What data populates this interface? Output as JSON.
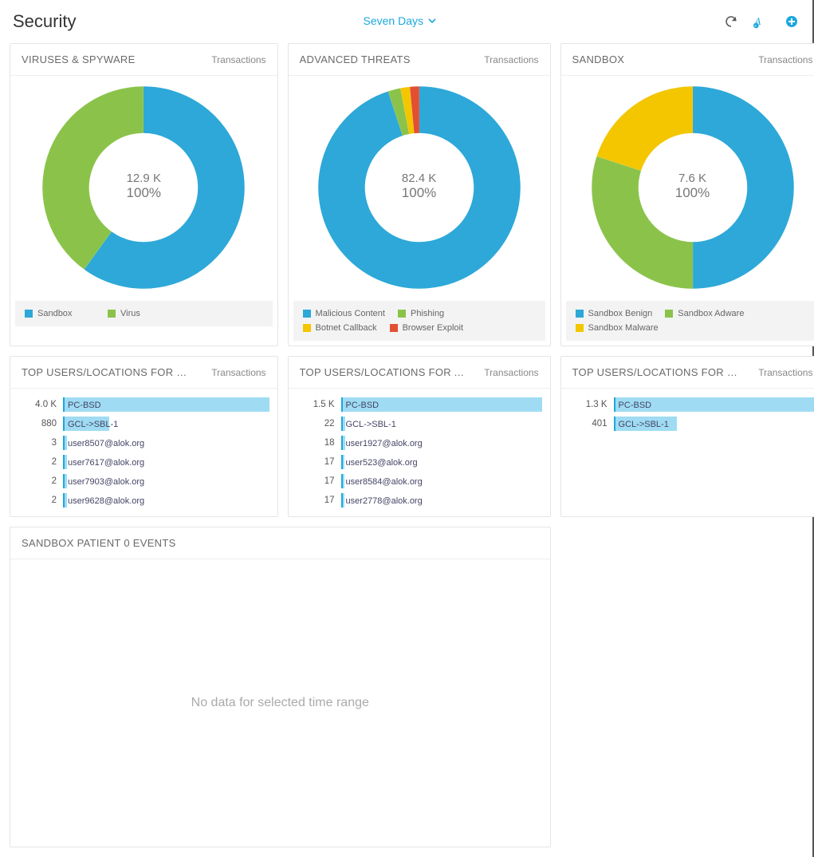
{
  "header": {
    "title": "Security",
    "timerange_label": "Seven Days"
  },
  "transactions_label": "Transactions",
  "chart_data": [
    {
      "id": "viruses",
      "type": "pie",
      "title": "VIRUSES & SPYWARE",
      "center_value": "12.9 K",
      "center_pct": "100%",
      "series": [
        {
          "name": "Sandbox",
          "value": 60,
          "color": "#2DA8D8"
        },
        {
          "name": "Virus",
          "value": 40,
          "color": "#8BC34A"
        }
      ]
    },
    {
      "id": "advanced",
      "type": "pie",
      "title": "ADVANCED THREATS",
      "center_value": "82.4 K",
      "center_pct": "100%",
      "series": [
        {
          "name": "Malicious Content",
          "value": 95,
          "color": "#2DA8D8"
        },
        {
          "name": "Phishing",
          "value": 2,
          "color": "#8BC34A"
        },
        {
          "name": "Botnet Callback",
          "value": 1.5,
          "color": "#F3C600"
        },
        {
          "name": "Browser Exploit",
          "value": 1.5,
          "color": "#E34F32"
        }
      ]
    },
    {
      "id": "sandbox",
      "type": "pie",
      "title": "SANDBOX",
      "center_value": "7.6 K",
      "center_pct": "100%",
      "series": [
        {
          "name": "Sandbox Benign",
          "value": 50,
          "color": "#2DA8D8"
        },
        {
          "name": "Sandbox Adware",
          "value": 30,
          "color": "#8BC34A"
        },
        {
          "name": "Sandbox Malware",
          "value": 20,
          "color": "#F3C600"
        }
      ]
    },
    {
      "id": "top_viruses",
      "type": "bar",
      "title": "TOP USERS/LOCATIONS FOR VIRU...",
      "max": 4000,
      "rows": [
        {
          "label": "PC-BSD",
          "value_display": "4.0 K",
          "value": 4000
        },
        {
          "label": "GCL->SBL-1",
          "value_display": "880",
          "value": 880
        },
        {
          "label": "user8507@alok.org",
          "value_display": "3",
          "value": 3
        },
        {
          "label": "user7617@alok.org",
          "value_display": "2",
          "value": 2
        },
        {
          "label": "user7903@alok.org",
          "value_display": "2",
          "value": 2
        },
        {
          "label": "user9628@alok.org",
          "value_display": "2",
          "value": 2
        }
      ]
    },
    {
      "id": "top_advanced",
      "type": "bar",
      "title": "TOP USERS/LOCATIONS FOR ADV...",
      "max": 1500,
      "rows": [
        {
          "label": "PC-BSD",
          "value_display": "1.5 K",
          "value": 1500
        },
        {
          "label": "GCL->SBL-1",
          "value_display": "22",
          "value": 22
        },
        {
          "label": "user1927@alok.org",
          "value_display": "18",
          "value": 18
        },
        {
          "label": "user523@alok.org",
          "value_display": "17",
          "value": 17
        },
        {
          "label": "user8584@alok.org",
          "value_display": "17",
          "value": 17
        },
        {
          "label": "user2778@alok.org",
          "value_display": "17",
          "value": 17
        }
      ]
    },
    {
      "id": "top_sandbox",
      "type": "bar",
      "title": "TOP USERS/LOCATIONS FOR SAN...",
      "max": 1300,
      "scroll": false,
      "rows": [
        {
          "label": "PC-BSD",
          "value_display": "1.3 K",
          "value": 1300
        },
        {
          "label": "GCL->SBL-1",
          "value_display": "401",
          "value": 401
        }
      ]
    }
  ],
  "patient0": {
    "title": "SANDBOX PATIENT 0 EVENTS",
    "empty_text": "No data for selected time range"
  }
}
